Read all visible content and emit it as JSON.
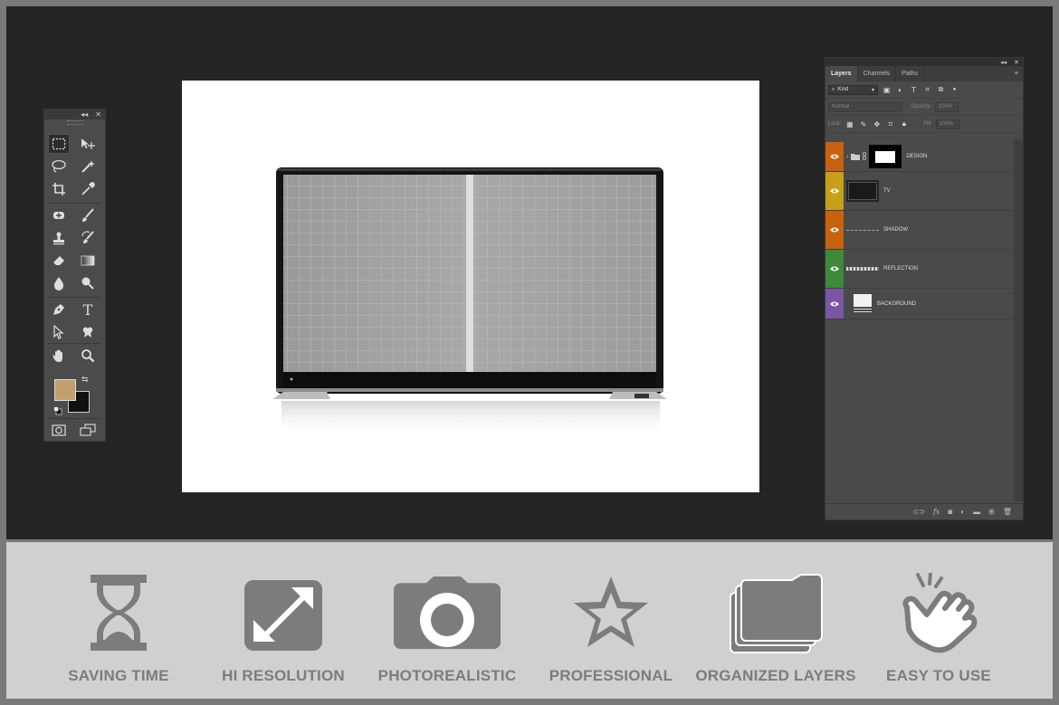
{
  "tools_panel": {
    "collapse_glyph": "◂◂",
    "close_glyph": "✕",
    "type_tool_glyph": "T",
    "foreground_color": "#c39f6c",
    "background_color": "#111111"
  },
  "layers_panel": {
    "collapse_glyph": "◂◂",
    "close_glyph": "✕",
    "menu_glyph": "≡",
    "tabs": [
      {
        "label": "Layers",
        "active": true
      },
      {
        "label": "Channels",
        "active": false
      },
      {
        "label": "Paths",
        "active": false
      }
    ],
    "filter_kind": "Kind",
    "blend_mode": "Normal",
    "opacity_label": "Opacity:",
    "opacity_value": "100%",
    "lock_label": "Lock:",
    "fill_label": "Fill:",
    "fill_value": "100%",
    "layers": [
      {
        "name": "DESIGN",
        "color": "#c8620e"
      },
      {
        "name": "TV",
        "color": "#c7a018"
      },
      {
        "name": "SHADOW",
        "color": "#c8620e"
      },
      {
        "name": "REFLECTION",
        "color": "#3e8a3a"
      },
      {
        "name": "BACKGROUND",
        "color": "#7d55a5"
      }
    ]
  },
  "features": [
    {
      "label": "SAVING TIME",
      "icon": "hourglass-icon"
    },
    {
      "label": "HI RESOLUTION",
      "icon": "expand-arrows-icon"
    },
    {
      "label": "PHOTOREALISTIC",
      "icon": "camera-icon"
    },
    {
      "label": "PROFESSIONAL",
      "icon": "star-icon"
    },
    {
      "label": "ORGANIZED LAYERS",
      "icon": "stacked-folders-icon"
    },
    {
      "label": "EASY TO USE",
      "icon": "pointing-hand-icon"
    }
  ]
}
